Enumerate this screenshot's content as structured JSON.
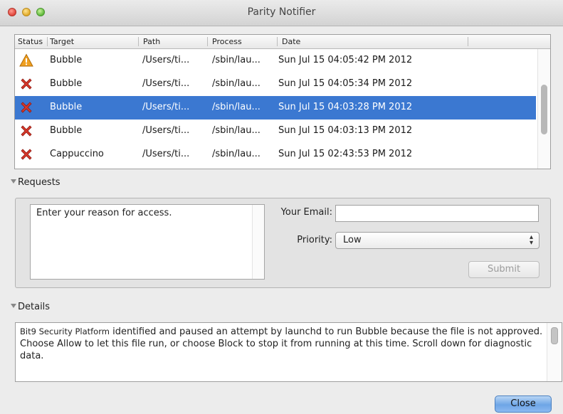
{
  "window": {
    "title": "Parity Notifier"
  },
  "table": {
    "columns": [
      "Status",
      "Target",
      "Path",
      "Process",
      "Date"
    ],
    "rows": [
      {
        "status": "warning",
        "target": "Bubble",
        "path": "/Users/ti...",
        "process": "/sbin/lau...",
        "date": "Sun Jul 15 04:05:42 PM 2012",
        "selected": false
      },
      {
        "status": "blocked",
        "target": "Bubble",
        "path": "/Users/ti...",
        "process": "/sbin/lau...",
        "date": "Sun Jul 15 04:05:34 PM 2012",
        "selected": false
      },
      {
        "status": "blocked",
        "target": "Bubble",
        "path": "/Users/ti...",
        "process": "/sbin/lau...",
        "date": "Sun Jul 15 04:03:28 PM 2012",
        "selected": true
      },
      {
        "status": "blocked",
        "target": "Bubble",
        "path": "/Users/ti...",
        "process": "/sbin/lau...",
        "date": "Sun Jul 15 04:03:13 PM 2012",
        "selected": false
      },
      {
        "status": "blocked",
        "target": "Cappuccino",
        "path": "/Users/ti...",
        "process": "/sbin/lau...",
        "date": "Sun Jul 15 02:43:53 PM 2012",
        "selected": false
      }
    ]
  },
  "requests": {
    "header": "Requests",
    "reason_text": "Enter your reason for access.",
    "email_label": "Your Email:",
    "email_value": "",
    "priority_label": "Priority:",
    "priority_value": "Low",
    "submit_label": "Submit"
  },
  "details": {
    "header": "Details",
    "brand": "Bit9 Security Platform",
    "text": " identified and paused an attempt by launchd to run Bubble because the file is not approved.  Choose Allow to let this file run, or choose Block to stop it from running at this time. Scroll down for diagnostic data."
  },
  "footer": {
    "close_label": "Close"
  },
  "colors": {
    "selection": "#3b78d1",
    "warning": "#f0a020",
    "blocked": "#d8382a"
  }
}
